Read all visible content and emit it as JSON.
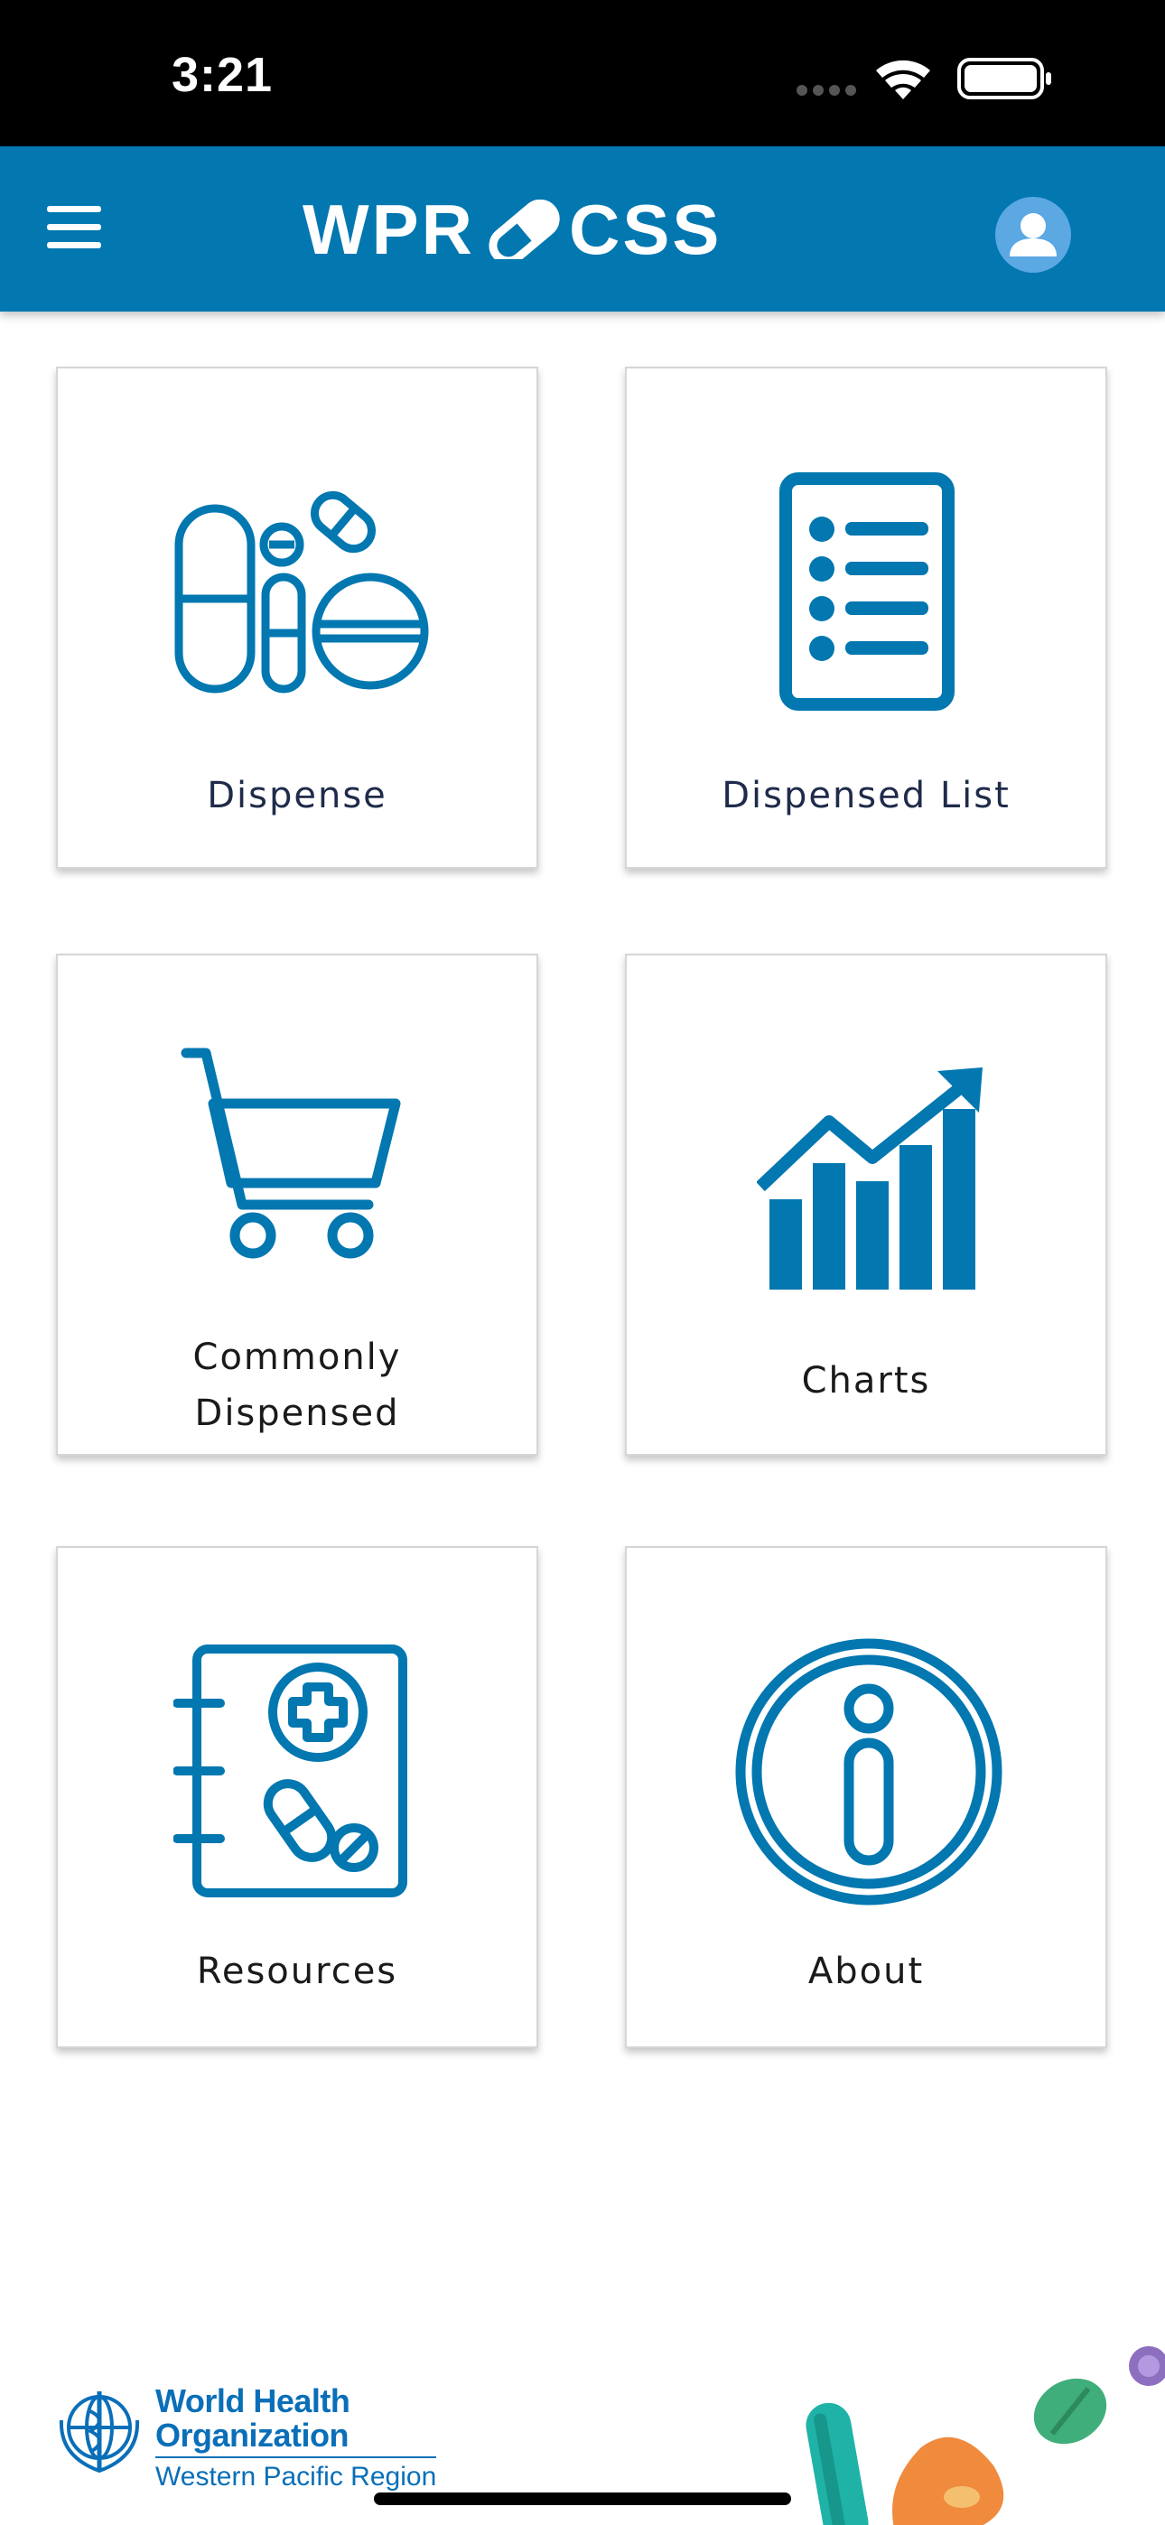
{
  "status_bar": {
    "time": "3:21"
  },
  "header": {
    "logo_left": "WPR",
    "logo_right": "CSS",
    "menu_icon": "hamburger-menu-icon",
    "avatar_icon": "user-avatar-icon",
    "color": "#0277b0"
  },
  "tiles": [
    {
      "label": "Dispense",
      "icon": "pills-icon"
    },
    {
      "label": "Dispensed List",
      "icon": "list-document-icon"
    },
    {
      "label_line1": "Commonly",
      "label_line2": "Dispensed",
      "icon": "shopping-cart-icon"
    },
    {
      "label": "Charts",
      "icon": "bar-chart-trend-icon"
    },
    {
      "label": "Resources",
      "icon": "medical-handbook-icon"
    },
    {
      "label": "About",
      "icon": "info-icon"
    }
  ],
  "footer": {
    "org_line1": "World Health",
    "org_line2": "Organization",
    "org_sub": "Western Pacific Region"
  },
  "colors": {
    "icon_blue": "#0277b0",
    "header_blue": "#0277b0"
  }
}
